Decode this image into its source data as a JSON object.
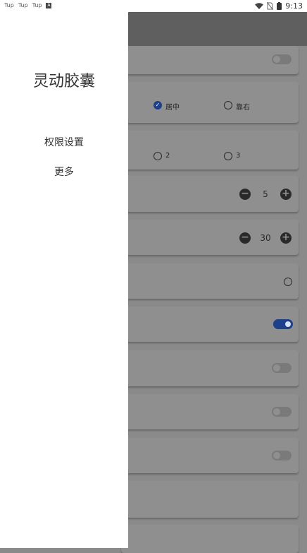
{
  "status_bar": {
    "left_icons": [
      "Tup",
      "Tup",
      "Tup"
    ],
    "notification_glyph": "A",
    "time": "9:13",
    "icons": [
      "wifi-icon",
      "no-sim-icon",
      "battery-icon"
    ]
  },
  "drawer": {
    "title": "灵动胶囊",
    "items": [
      {
        "label": "权限设置"
      },
      {
        "label": "更多"
      }
    ]
  },
  "settings": {
    "position_options": [
      {
        "label": "居中",
        "checked": true
      },
      {
        "label": "靠右",
        "checked": false
      }
    ],
    "count_options": [
      {
        "label": "2",
        "checked": false
      },
      {
        "label": "3",
        "checked": false
      }
    ],
    "stepper_1": {
      "minus": "−",
      "value": "5",
      "plus": "+"
    },
    "stepper_2": {
      "minus": "−",
      "value": "30",
      "plus": "+"
    },
    "toggles": [
      {
        "state": "off"
      },
      {
        "state": "on"
      },
      {
        "state": "off"
      },
      {
        "state": "off"
      },
      {
        "state": "off"
      }
    ]
  },
  "colors": {
    "accent": "#1e3f8a",
    "scrim_bg": "#8a8a8a",
    "drawer_bg": "#ffffff"
  }
}
